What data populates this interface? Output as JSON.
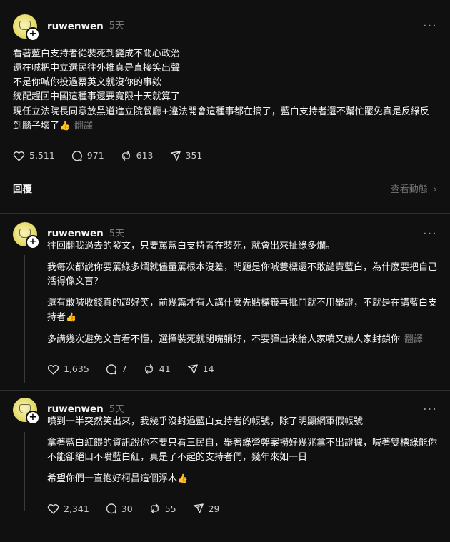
{
  "post": {
    "username": "ruwenwen",
    "time": "5天",
    "paragraphs": [
      "看著藍白支持者從裝死到變成不關心政治\n還在喊把中立選民往外推真是直接笑出聲\n不是你喊你投過蔡英文就沒你的事欸",
      "統配趕回中國這種事還要寬限十天就算了\n現任立法院長同意放黑道進立院餐廳+違法開會這種事都在搞了，藍白支持者還不幫忙罷免真是反綠反到腦子壞了"
    ],
    "translate": "翻譯",
    "likes": "5,511",
    "comments": "971",
    "reposts": "613",
    "shares": "351"
  },
  "replies_header": {
    "title": "回覆",
    "view_activity": "查看動態"
  },
  "replies": [
    {
      "username": "ruwenwen",
      "time": "5天",
      "paragraphs": [
        "往回翻我過去的發文，只要罵藍白支持者在裝死，就會出來扯綠多爛。",
        "我每次都說你要罵綠多爛就儘量罵根本沒差，問題是你喊雙標還不敢譴責藍白，為什麼要把自己活得像文盲？",
        "還有敢喊收錢真的超好笑，前幾篇才有人講什麼先貼標籤再批鬥就不用舉證，不就是在講藍白支持者",
        "多講幾次避免文盲看不懂，選擇裝死就閉嘴躺好，不要彈出來給人家噴又嫌人家封鎖你"
      ],
      "translate": "翻譯",
      "likes": "1,635",
      "comments": "7",
      "reposts": "41",
      "shares": "14"
    },
    {
      "username": "ruwenwen",
      "time": "5天",
      "paragraphs": [
        "噴到一半突然笑出來，我幾乎沒封過藍白支持者的帳號，除了明顯網軍假帳號",
        "拿著藍白紅餵的資訊說你不要只看三民自，舉著綠營弊案撈好幾兆拿不出證據，喊著雙標綠能你不能卻絕口不噴藍白紅，真是了不起的支持者們，幾年來如一日",
        "希望你們一直抱好柯昌這個浮木"
      ],
      "likes": "2,341",
      "comments": "30",
      "reposts": "55",
      "shares": "29"
    }
  ]
}
